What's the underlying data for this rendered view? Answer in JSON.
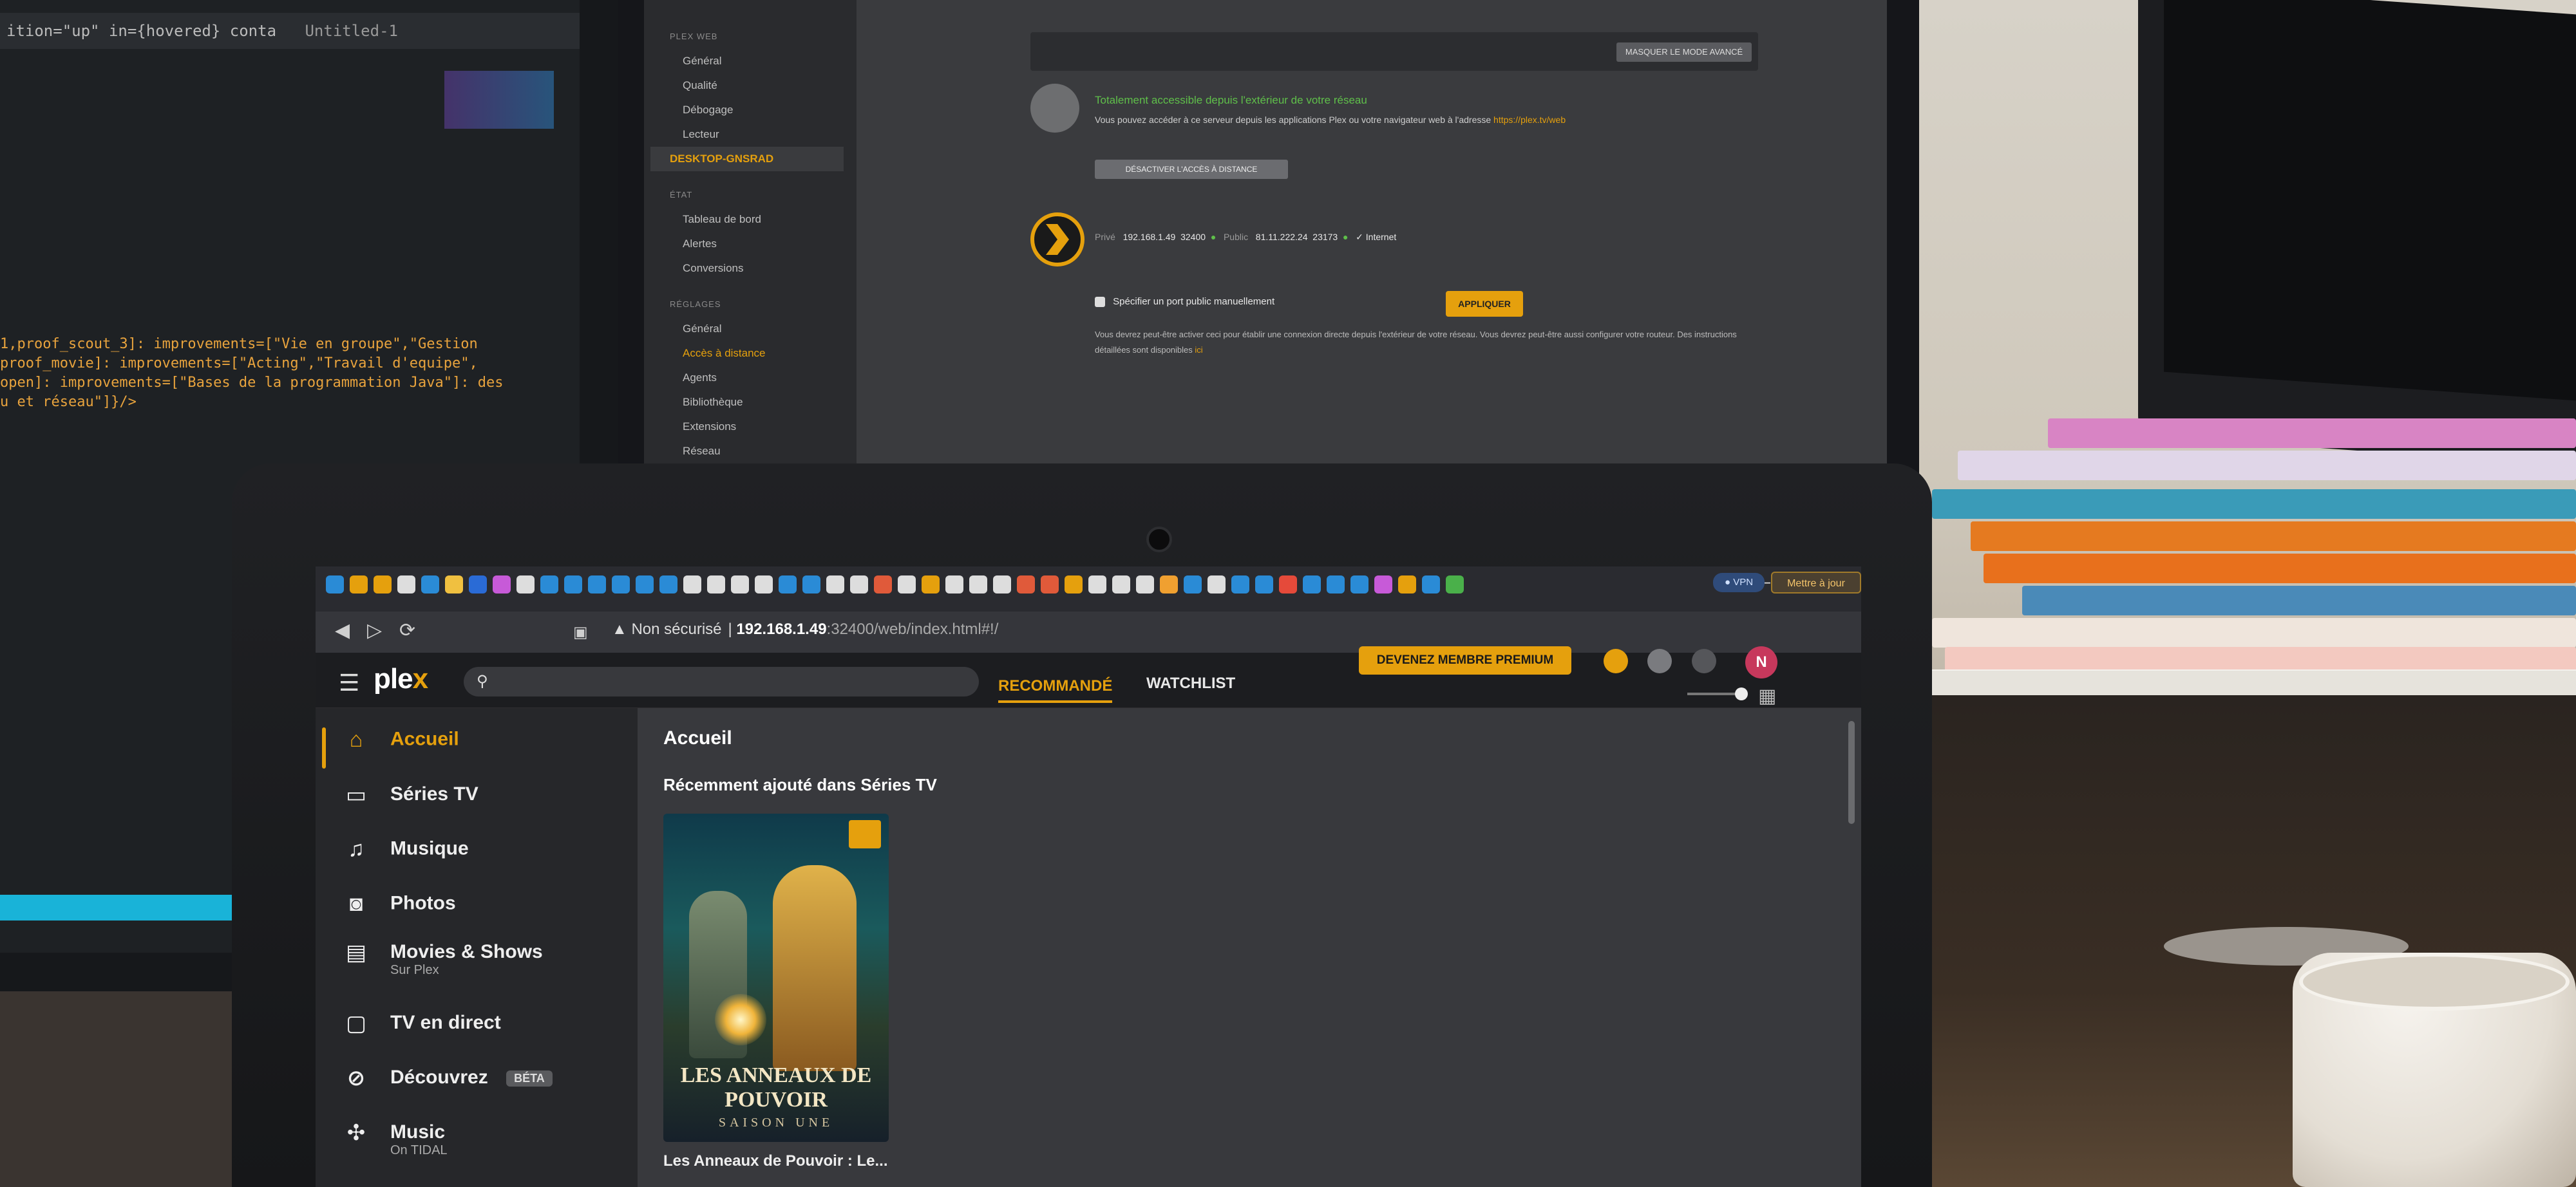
{
  "editor": {
    "tab_text": "ition=\"up\" in={hovered} conta",
    "untitled": "Untitled-1",
    "code": [
      "1,proof_scout_3]: improvements=[\"Vie en groupe\",\"Gestion",
      "proof_movie]: improvements=[\"Acting\",\"Travail d'equipe\",",
      "open]: improvements=[\"Bases de la programmation Java\"]: des",
      "u et réseau\"]}/>"
    ]
  },
  "plex_settings": {
    "sidebar": {
      "section_plex_web": "PLEX WEB",
      "plex_web_items": [
        "Général",
        "Qualité",
        "Débogage",
        "Lecteur"
      ],
      "server_name": "DESKTOP-GNSRAD",
      "section_server": "ÉTAT",
      "status_items": [
        "Tableau de bord",
        "Alertes",
        "Conversions"
      ],
      "section_settings": "RÉGLAGES",
      "settings_items": [
        "Général",
        "Accès à distance",
        "Agents",
        "Bibliothèque",
        "Extensions",
        "Réseau"
      ]
    },
    "hide_button": "MASQUER LE MODE AVANCÉ",
    "remote_status_title": "Totalement accessible depuis l'extérieur de votre réseau",
    "remote_status_desc": "Vous pouvez accéder à ce serveur depuis les applications Plex ou votre navigateur web à l'adresse",
    "remote_status_link": "https://plex.tv/web",
    "disable_button": "DÉSACTIVER L'ACCÈS À DISTANCE",
    "private_label": "Privé",
    "private_ip": "192.168.1.49",
    "private_port": "32400",
    "public_label": "Public",
    "public_ip": "81.11.222.24",
    "public_port": "23173",
    "internet_label": "Internet",
    "manual_port_label": "Spécifier un port public manuellement",
    "apply_button": "APPLIQUER",
    "note_text": "Vous devrez peut-être activer ceci pour établir une connexion directe depuis l'extérieur de votre réseau. Vous devrez peut-être aussi configurer votre routeur. Des instructions détaillées sont disponibles",
    "note_link": "ici"
  },
  "browser": {
    "tab_favicon_colors": [
      "#2a8bd6",
      "#e5a00d",
      "#e5a00d",
      "#ddd",
      "#2a8bd6",
      "#f0c040",
      "#2a6bd6",
      "#c75ad8",
      "#ddd",
      "#2a8bd6",
      "#2a8bd6",
      "#2a8bd6",
      "#2a8bd6",
      "#2a8bd6",
      "#2a8bd6",
      "#ddd",
      "#ddd",
      "#ddd",
      "#ddd",
      "#2a8bd6",
      "#2a8bd6",
      "#ddd",
      "#ddd",
      "#e05a3a",
      "#ddd",
      "#e5a00d",
      "#ddd",
      "#ddd",
      "#ddd",
      "#e05a3a",
      "#e05a3a",
      "#e5a00d",
      "#ddd",
      "#ddd",
      "#ddd",
      "#f0a030",
      "#2a8bd6",
      "#ddd",
      "#2a8bd6",
      "#2a8bd6",
      "#e54a3a",
      "#2a8bd6",
      "#2a8bd6",
      "#2a8bd6",
      "#c75ad8",
      "#e5a00d",
      "#2a8bd6",
      "#4ab04a"
    ],
    "insecure_label": "Non sécurisé",
    "url_host": "192.168.1.49",
    "url_path": ":32400/web/index.html#!/",
    "vpn_label": "VPN",
    "update_label": "Mettre à jour"
  },
  "plex": {
    "logo_text_1": "ple",
    "logo_text_2": "x",
    "search_placeholder": "",
    "premium_button": "DEVENEZ MEMBRE PREMIUM",
    "avatar_letter": "N",
    "tabs": [
      {
        "label": "RECOMMANDÉ",
        "active": true
      },
      {
        "label": "WATCHLIST",
        "active": false
      }
    ],
    "sidebar": [
      {
        "label": "Accueil",
        "icon": "home-icon",
        "active": true
      },
      {
        "label": "Séries TV",
        "icon": "tv-icon"
      },
      {
        "label": "Musique",
        "icon": "music-icon"
      },
      {
        "label": "Photos",
        "icon": "camera-icon"
      },
      {
        "label": "Movies & Shows",
        "sub": "Sur Plex",
        "icon": "film-icon"
      },
      {
        "label": "TV en direct",
        "icon": "live-tv-icon"
      },
      {
        "label": "Découvrez",
        "badge": "BÉTA",
        "icon": "compass-icon"
      },
      {
        "label": "Music",
        "sub": "On TIDAL",
        "icon": "tidal-icon"
      }
    ],
    "page_title": "Accueil",
    "hub_title": "Récemment ajouté dans Séries TV",
    "poster_title": "LES ANNEAUX DE POUVOIR",
    "poster_subtitle": "SAISON UNE",
    "poster_caption": "Les Anneaux de Pouvoir : Le..."
  },
  "colors": {
    "plex_accent": "#e5a00d",
    "remote_ok": "#5fbf4a"
  }
}
